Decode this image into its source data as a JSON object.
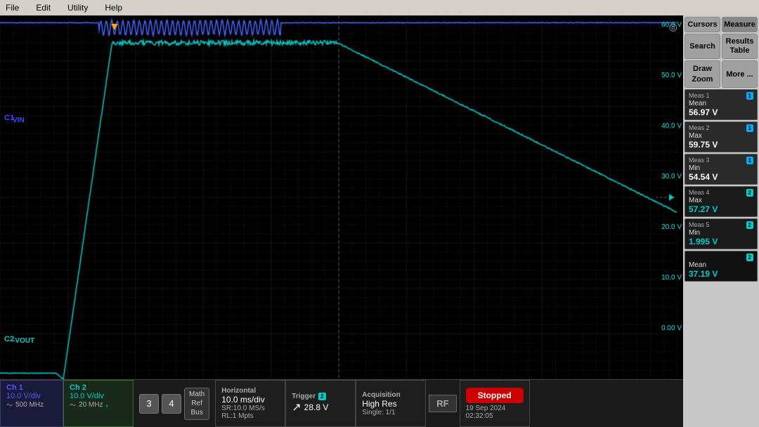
{
  "menubar": {
    "items": [
      "File",
      "Edit",
      "Utility",
      "Help"
    ]
  },
  "scope": {
    "ch1_label": "C1",
    "ch1_name": "VIN",
    "ch2_label": "C2",
    "ch2_name": "-VOUT",
    "y_labels": [
      "60.0 V",
      "50.0 V",
      "40.0 V",
      "30.0 V",
      "20.0 V",
      "10.0 V",
      "0.00 V"
    ]
  },
  "right_panel": {
    "cursors_label": "Cursors",
    "measure_label": "Measure",
    "search_label": "Search",
    "results_table_label": "Results\nTable",
    "draw_zoom_label": "Draw\nZoom",
    "more_label": "More ...",
    "meas1": {
      "title": "Meas 1",
      "badge": "1",
      "type": "Mean",
      "value": "56.97 V"
    },
    "meas2": {
      "title": "Meas 2",
      "badge": "1",
      "type": "Max",
      "value": "59.75 V"
    },
    "meas3": {
      "title": "Meas 3",
      "badge": "1",
      "type": "Min",
      "value": "54.54 V"
    },
    "meas4": {
      "title": "Meas 4",
      "badge": "2",
      "type": "Max",
      "value": "57.27 V"
    },
    "meas5": {
      "title": "Meas 5",
      "badge": "2",
      "type": "Min",
      "value": "1.995 V"
    },
    "meas6": {
      "title": "",
      "badge": "2",
      "type": "Mean",
      "value": "37.19 V"
    }
  },
  "status_bar": {
    "ch1": {
      "label": "Ch 1",
      "div": "10.0 V/div",
      "bw": "500 MHz"
    },
    "ch2": {
      "label": "Ch 2",
      "div": "10.0 V/div",
      "bw": "20 MHz"
    },
    "btn3": "3",
    "btn4": "4",
    "math_ref_bus": "Math\nRef\nBus",
    "horizontal": {
      "title": "Horizontal",
      "div": "10.0 ms/div",
      "sr": "SR:10.0 MS/s",
      "rl": "RL:1 Mpts"
    },
    "trigger": {
      "title": "Trigger",
      "badge": "2",
      "value": "28.8 V"
    },
    "acquisition": {
      "title": "Acquisition",
      "mode": "High Res",
      "single": "Single: 1/1"
    },
    "rf_label": "RF",
    "stopped_label": "Stopped",
    "datetime": "19 Sep 2024\n02:32:05"
  }
}
